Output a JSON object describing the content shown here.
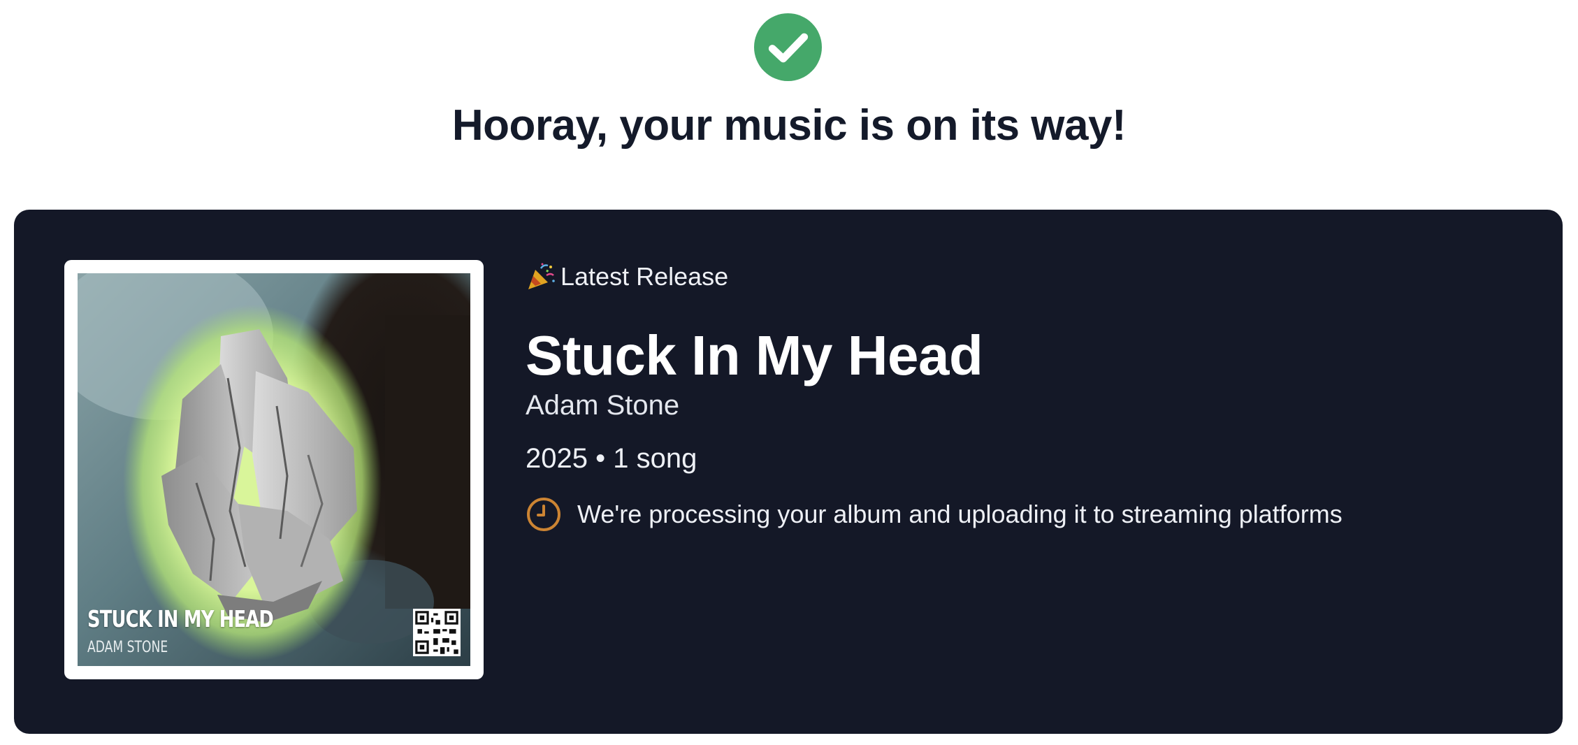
{
  "header": {
    "success_icon": "check-circle-icon",
    "success_color": "#45a86a",
    "title": "Hooray, your music is on its way!"
  },
  "release": {
    "tag_icon": "party-popper-icon",
    "tag_label": "Latest Release",
    "title": "Stuck In My Head",
    "artist": "Adam Stone",
    "meta": "2025 • 1 song",
    "status_icon": "clock-icon",
    "status_color": "#cc8433",
    "status_text": "We're processing your album and uploading it to streaming platforms"
  },
  "cover": {
    "title": "STUCK IN MY HEAD",
    "artist": "ADAM STONE",
    "qr_icon": "qr-code-icon"
  },
  "colors": {
    "card_background": "#141827",
    "heading_text": "#141a2a"
  }
}
